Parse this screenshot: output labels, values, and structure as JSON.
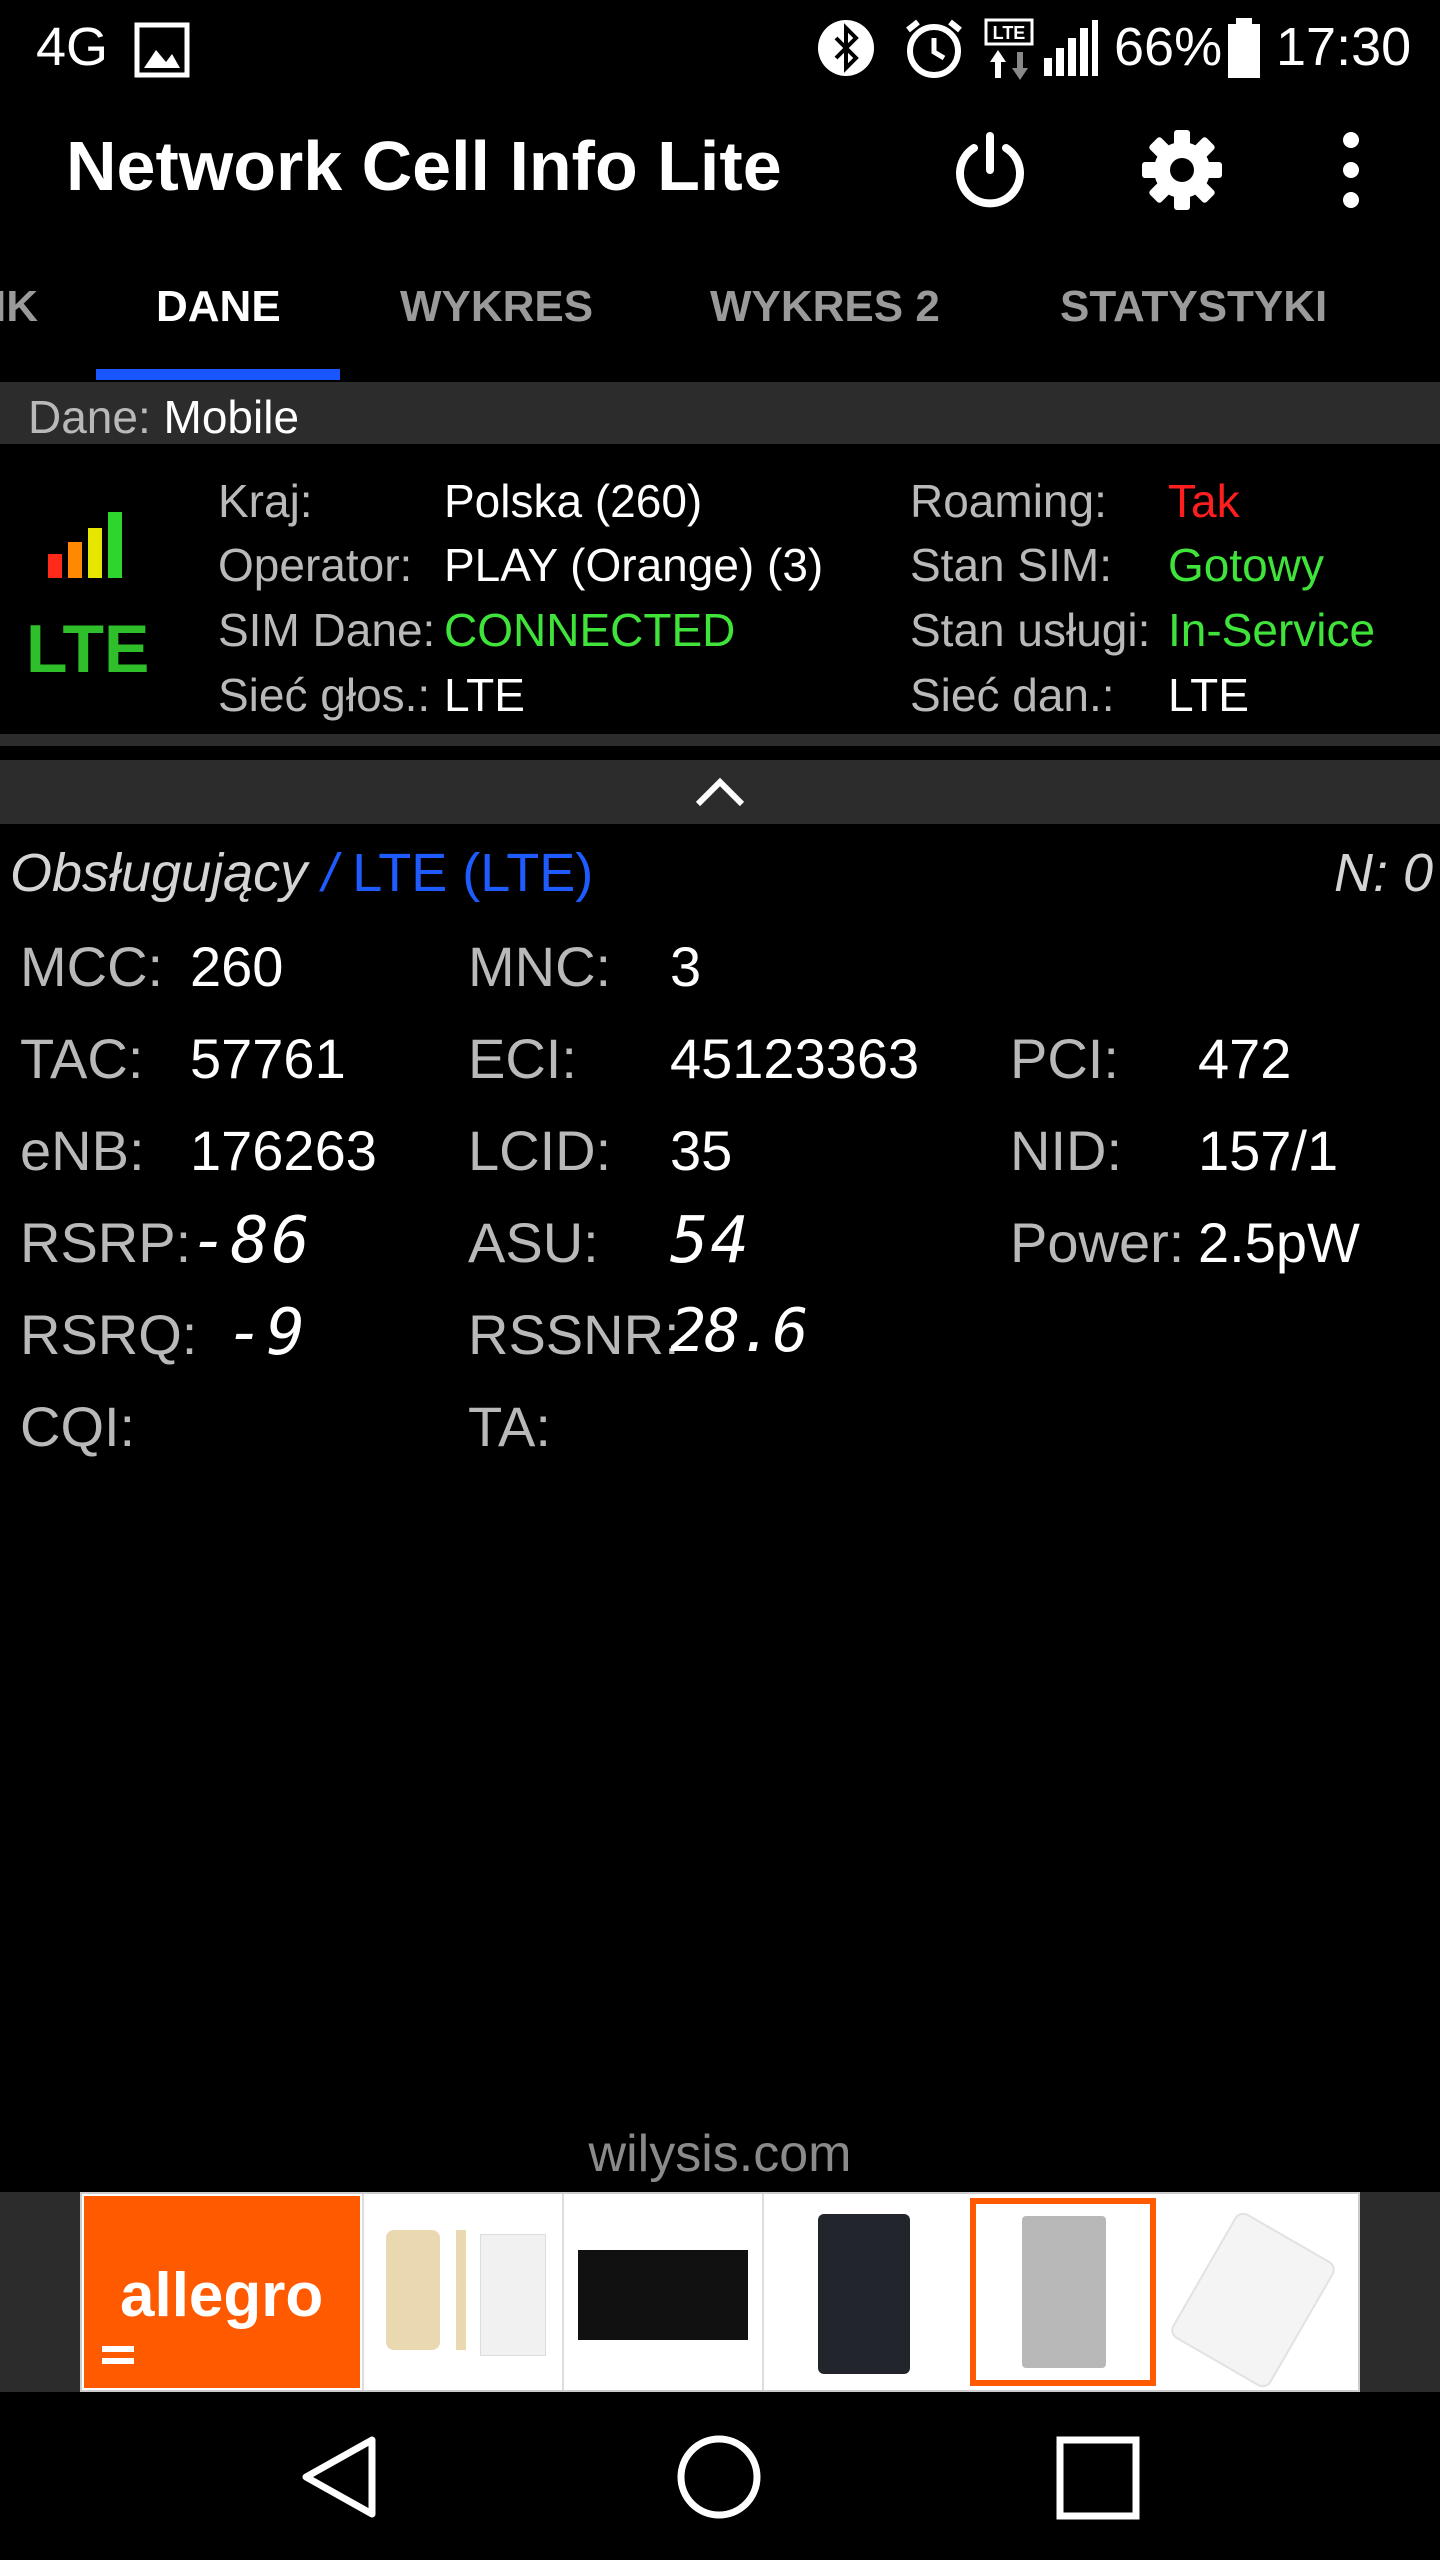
{
  "status_bar": {
    "network_type": "4G",
    "battery_percent": "66%",
    "time": "17:30",
    "icons": [
      "image-icon",
      "bluetooth-icon",
      "alarm-icon",
      "lte-data-icon",
      "signal-icon",
      "battery-icon"
    ]
  },
  "app_bar": {
    "title": "Network Cell Info Lite",
    "icons": [
      "power-icon",
      "settings-gear-icon",
      "more-vert-icon"
    ]
  },
  "tabs": {
    "partial": "IK",
    "dane": "DANE",
    "wykres": "WYKRES",
    "wykres2": "WYKRES 2",
    "statystyki": "STATYSTYKI",
    "active": "DANE"
  },
  "data_header": {
    "label": "Dane:",
    "value": "Mobile"
  },
  "network_badge": {
    "tech": "LTE"
  },
  "info": {
    "kraj": {
      "label": "Kraj:",
      "value": "Polska (260)"
    },
    "operator": {
      "label": "Operator:",
      "value": "PLAY (Orange) (3)"
    },
    "sim_dane": {
      "label": "SIM Dane:",
      "value": "CONNECTED"
    },
    "siec_glos": {
      "label": "Sieć głos.:",
      "value": "LTE"
    },
    "roaming": {
      "label": "Roaming:",
      "value": "Tak"
    },
    "stan_sim": {
      "label": "Stan SIM:",
      "value": "Gotowy"
    },
    "stan_uslugi": {
      "label": "Stan usługi:",
      "value": "In-Service"
    },
    "siec_dan": {
      "label": "Sieć dan.:",
      "value": "LTE"
    }
  },
  "serving": {
    "title": "Obsługujący",
    "sep": " / ",
    "tech": "LTE (LTE)",
    "n": "N: 0"
  },
  "cell": {
    "mcc": {
      "label": "MCC:",
      "value": "260"
    },
    "mnc": {
      "label": "MNC:",
      "value": "3"
    },
    "tac": {
      "label": "TAC:",
      "value": "57761"
    },
    "eci": {
      "label": "ECI:",
      "value": "45123363"
    },
    "pci": {
      "label": "PCI:",
      "value": "472"
    },
    "enb": {
      "label": "eNB:",
      "value": "176263"
    },
    "lcid": {
      "label": "LCID:",
      "value": "35"
    },
    "nid": {
      "label": "NID:",
      "value": "157/1"
    },
    "rsrp": {
      "label": "RSRP:",
      "value": "-86"
    },
    "asu": {
      "label": "ASU:",
      "value": "54"
    },
    "power": {
      "label": "Power:",
      "value": "2.5pW"
    },
    "rsrq": {
      "label": "RSRQ:",
      "value": "-9"
    },
    "rssnr": {
      "label": "RSSNR:",
      "value": "28.6"
    },
    "cqi": {
      "label": "CQI:",
      "value": ""
    },
    "ta": {
      "label": "TA:",
      "value": ""
    }
  },
  "footer": {
    "site": "wilysis.com"
  },
  "ad": {
    "brand": "allegro"
  },
  "nav": {
    "icons": [
      "back-icon",
      "home-icon",
      "recents-icon"
    ]
  },
  "colors": {
    "accent": "#1a56ff",
    "good": "#3fe33a",
    "bad": "#ff1e1e",
    "panel": "#2c2c2c"
  }
}
